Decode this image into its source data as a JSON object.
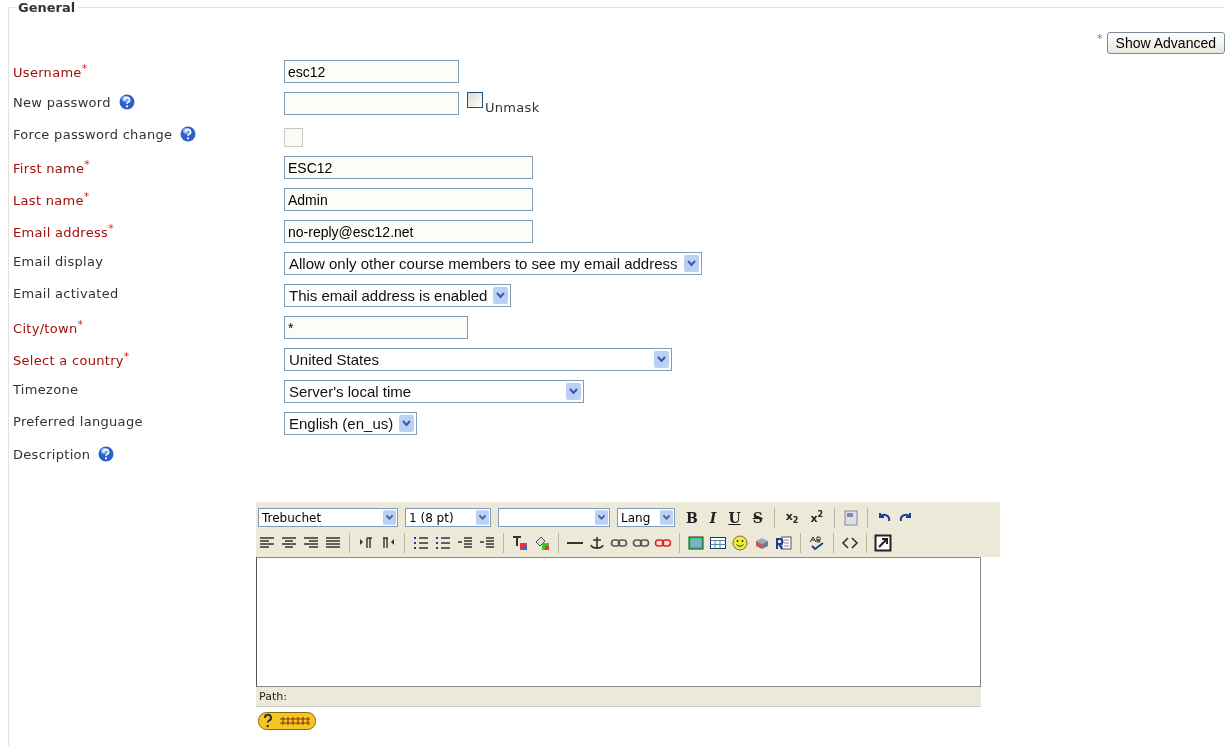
{
  "legend": "General",
  "advanced": {
    "mark": "*",
    "button": "Show Advanced"
  },
  "fields": [
    {
      "label": "Username",
      "required": true,
      "mark": "*",
      "help": false,
      "kind": "text",
      "value": "esc12"
    },
    {
      "label": "New password",
      "required": false,
      "help": true,
      "kind": "password",
      "unmask": {
        "label": "Unmask",
        "checked": false
      }
    },
    {
      "label": "Force password change",
      "required": false,
      "help": true,
      "kind": "checkbox",
      "checked": false,
      "disabled": true
    },
    {
      "label": "First name",
      "required": true,
      "mark": "*",
      "help": false,
      "kind": "text",
      "value": "ESC12"
    },
    {
      "label": "Last name",
      "required": true,
      "mark": "*",
      "help": false,
      "kind": "text",
      "value": "Admin"
    },
    {
      "label": "Email address",
      "required": true,
      "mark": "*",
      "help": false,
      "kind": "text",
      "value": "no-reply@esc12.net"
    },
    {
      "label": "Email display",
      "required": false,
      "help": false,
      "kind": "select",
      "value": "Allow only other course members to see my email address"
    },
    {
      "label": "Email activated",
      "required": false,
      "help": false,
      "kind": "select",
      "value": "This email address is enabled"
    },
    {
      "label": "City/town",
      "required": true,
      "mark": "*",
      "help": false,
      "kind": "text",
      "value": "*"
    },
    {
      "label": "Select a country",
      "required": true,
      "mark": "*",
      "help": false,
      "kind": "select",
      "value": "United States"
    },
    {
      "label": "Timezone",
      "required": false,
      "help": false,
      "kind": "select",
      "value": "Server's local time"
    },
    {
      "label": "Preferred language",
      "required": false,
      "help": false,
      "kind": "select",
      "value": "English (en_us)"
    },
    {
      "label": "Description",
      "required": false,
      "help": true,
      "kind": "editor"
    }
  ],
  "editor": {
    "selects": [
      {
        "kind": "font",
        "value": "Trebuchet"
      },
      {
        "kind": "size",
        "value": "1 (8 pt)"
      },
      {
        "kind": "format"
      },
      {
        "kind": "language",
        "value": "Lang"
      }
    ],
    "format_buttons": [
      "B",
      "I",
      "U",
      "S"
    ],
    "script_buttons": [
      {
        "base": "x",
        "sub": "2"
      },
      {
        "base": "x",
        "sup": "2"
      }
    ],
    "path_label": "Path:"
  }
}
